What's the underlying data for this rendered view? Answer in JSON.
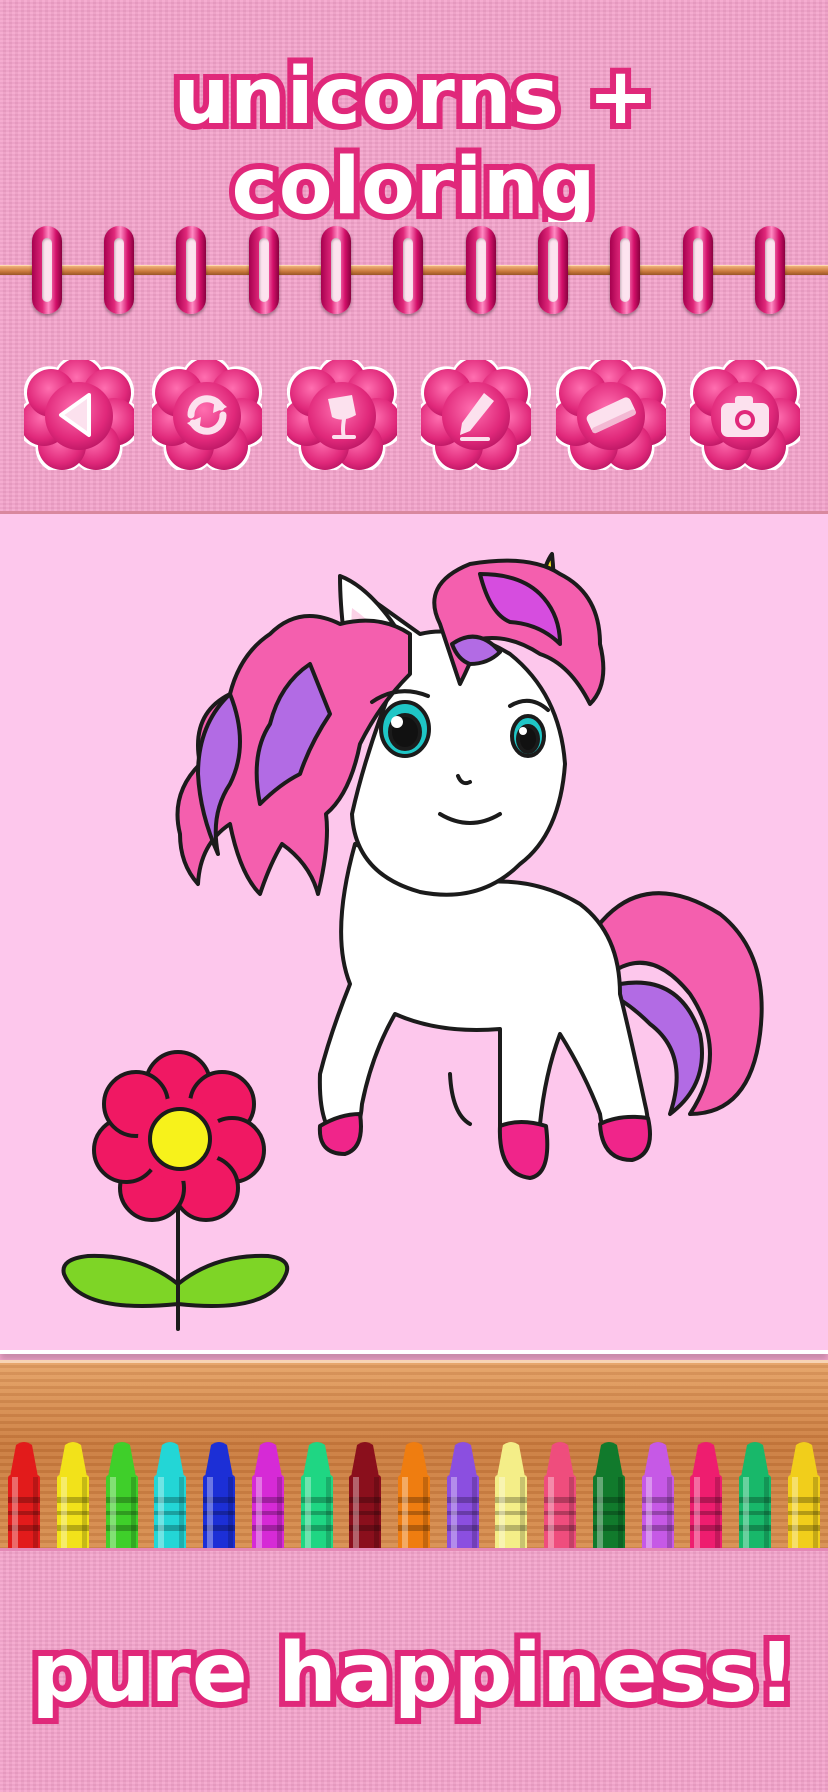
{
  "header": {
    "title": "unicorns + coloring"
  },
  "binding": {
    "ring_count": 11
  },
  "toolbar": {
    "buttons": [
      {
        "name": "back",
        "icon": "back-arrow-icon"
      },
      {
        "name": "reset",
        "icon": "refresh-icon"
      },
      {
        "name": "fill",
        "icon": "paint-bucket-icon"
      },
      {
        "name": "pencil",
        "icon": "pencil-icon"
      },
      {
        "name": "eraser",
        "icon": "eraser-icon"
      },
      {
        "name": "camera",
        "icon": "camera-icon"
      }
    ]
  },
  "canvas": {
    "drawing": "unicorn-coloring-page",
    "accent_pink": "#e0287a"
  },
  "crayons": {
    "colors": [
      "#e21b1b",
      "#f2e21a",
      "#3fcf2a",
      "#23d6d6",
      "#1c2fd6",
      "#d62ad6",
      "#1fd683",
      "#8a0f1c",
      "#ef7d10",
      "#8b4fe0",
      "#f4ee88",
      "#ef4d7d",
      "#117a2c",
      "#c659e6",
      "#ee1d6f",
      "#18b86a",
      "#f1ce1b"
    ]
  },
  "footer": {
    "tagline": "pure happiness!"
  }
}
